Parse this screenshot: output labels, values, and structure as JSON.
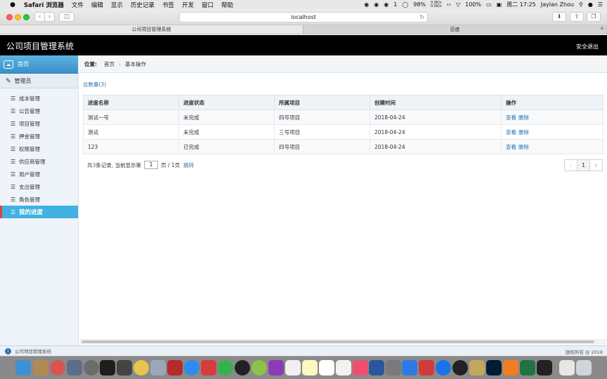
{
  "menubar": {
    "app": "Safari 浏览器",
    "items": [
      "文件",
      "编辑",
      "显示",
      "历史记录",
      "书签",
      "开发",
      "窗口",
      "帮助"
    ],
    "battery": "98%",
    "net_up": "0.0K/s",
    "net_down": "0.0K/s",
    "notif_count": "1",
    "battery2": "100%",
    "clock": "周二 17:25",
    "user": "Jaylan Zhou"
  },
  "browser": {
    "url": "localhost",
    "tabs": [
      "公司项目管理系统",
      "百度"
    ]
  },
  "app": {
    "title": "公司项目管理系统",
    "logout": "安全退出"
  },
  "sidebar": {
    "home": "首页",
    "group": "管理员",
    "items": [
      "成本管理",
      "公告管理",
      "项目管理",
      "押金管理",
      "权限管理",
      "供应商管理",
      "用户管理",
      "支出管理",
      "角色管理"
    ],
    "active": "我的进度"
  },
  "breadcrumb": {
    "label": "位置:",
    "home": "首页",
    "current": "基本操作"
  },
  "summary": {
    "total_label": "总数量(3)"
  },
  "table": {
    "headers": [
      "进度名称",
      "进度状态",
      "所属项目",
      "创建时间",
      "操作"
    ],
    "rows": [
      {
        "name": "测试一号",
        "status": "未完成",
        "project": "四号项目",
        "date": "2018-04-24"
      },
      {
        "name": "测试",
        "status": "未完成",
        "project": "三号项目",
        "date": "2018-04-24"
      },
      {
        "name": "123",
        "status": "已完成",
        "project": "四号项目",
        "date": "2018-04-24"
      }
    ],
    "action_view": "查看",
    "action_delete": "删除"
  },
  "pagination": {
    "prefix": "共",
    "count": "3",
    "mid": "条记录, 当前显示第",
    "page": "1",
    "suffix": "页 / 1页",
    "jump": "跳转",
    "current": "1"
  },
  "status": {
    "left": "公司项目管理系统",
    "right": "版权所有 @ 2018"
  }
}
